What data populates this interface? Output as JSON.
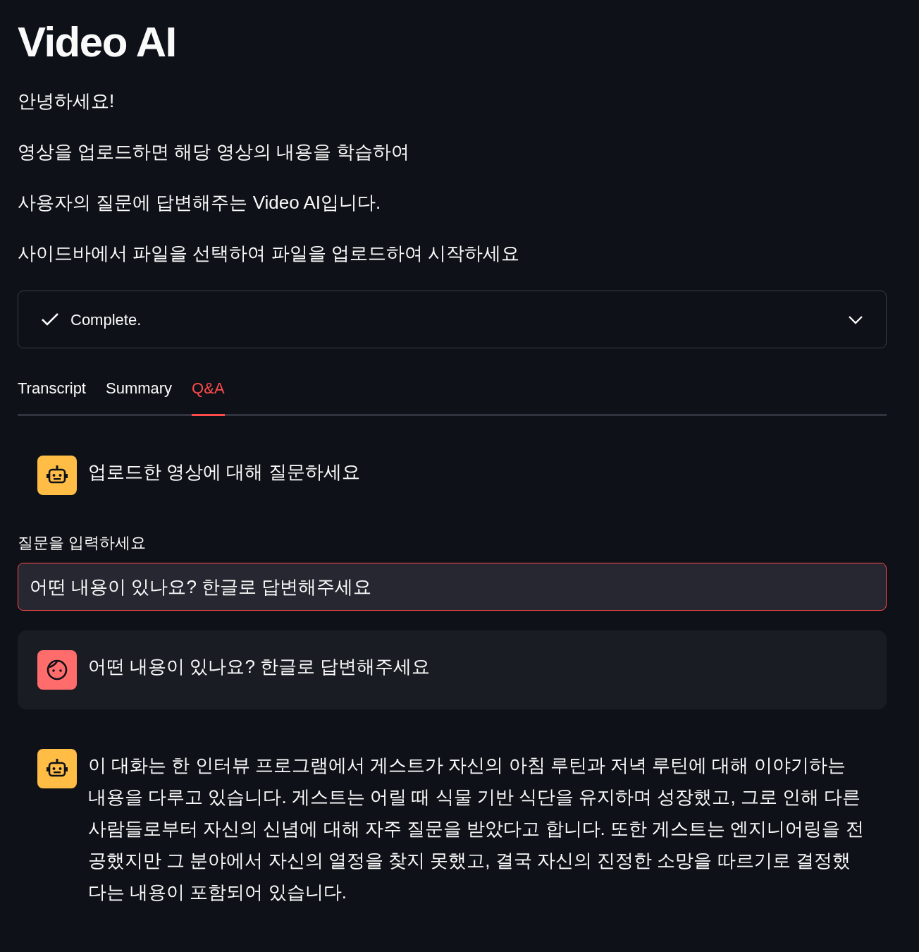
{
  "title": "Video AI",
  "intro": [
    "안녕하세요!",
    "영상을 업로드하면 해당 영상의 내용을 학습하여",
    "사용자의 질문에 답변해주는 Video AI입니다.",
    "사이드바에서 파일을 선택하여 파일을 업로드하여 시작하세요"
  ],
  "status": {
    "label": "Complete.",
    "kind": "complete",
    "expanded": false
  },
  "tabs": [
    {
      "label": "Transcript",
      "selected": false
    },
    {
      "label": "Summary",
      "selected": false
    },
    {
      "label": "Q&A",
      "selected": true
    }
  ],
  "greeting": {
    "kind": "assistant",
    "text": "업로드한 영상에 대해 질문하세요"
  },
  "question_input": {
    "label": "질문을 입력하세요",
    "value": "어떤 내용이 있나요? 한글로 답변해주세요",
    "focused": true
  },
  "messages": [
    {
      "kind": "user",
      "text": "어떤 내용이 있나요? 한글로 답변해주세요"
    },
    {
      "kind": "assistant",
      "text": "이 대화는 한 인터뷰 프로그램에서 게스트가 자신의 아침 루틴과 저녁 루틴에 대해 이야기하는 내용을 다루고 있습니다. 게스트는 어릴 때 식물 기반 식단을 유지하며 성장했고, 그로 인해 다른 사람들로부터 자신의 신념에 대해 자주 질문을 받았다고 합니다. 또한 게스트는 엔지니어링을 전공했지만 그 분야에서 자신의 열정을 찾지 못했고, 결국 자신의 진정한 소망을 따르기로 결정했다는 내용이 포함되어 있습니다."
    }
  ]
}
